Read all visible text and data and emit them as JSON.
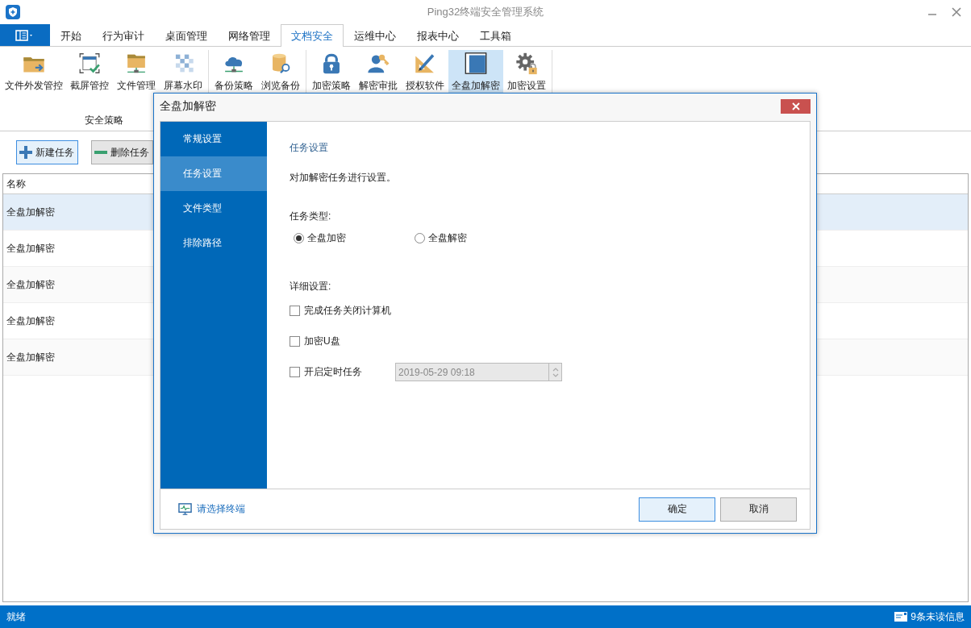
{
  "window": {
    "title": "Ping32终端安全管理系统"
  },
  "tabs": [
    {
      "label": "开始",
      "selected": false
    },
    {
      "label": "行为审计",
      "selected": false
    },
    {
      "label": "桌面管理",
      "selected": false
    },
    {
      "label": "网络管理",
      "selected": false
    },
    {
      "label": "文档安全",
      "selected": true
    },
    {
      "label": "运维中心",
      "selected": false
    },
    {
      "label": "报表中心",
      "selected": false
    },
    {
      "label": "工具箱",
      "selected": false
    }
  ],
  "ribbon": {
    "groups": [
      {
        "label": "安全策略",
        "items": [
          {
            "label": "文件外发管控",
            "selected": false
          },
          {
            "label": "截屏管控",
            "selected": false
          },
          {
            "label": "文件管理",
            "selected": false
          },
          {
            "label": "屏幕水印",
            "selected": false
          }
        ]
      },
      {
        "items": [
          {
            "label": "备份策略",
            "selected": false
          },
          {
            "label": "浏览备份",
            "selected": false
          }
        ]
      },
      {
        "items": [
          {
            "label": "加密策略",
            "selected": false
          },
          {
            "label": "解密审批",
            "selected": false
          },
          {
            "label": "授权软件",
            "selected": false
          },
          {
            "label": "全盘加解密",
            "selected": true
          },
          {
            "label": "加密设置",
            "selected": false
          }
        ]
      }
    ]
  },
  "toolbar": [
    {
      "label": "新建任务",
      "kind": "add"
    },
    {
      "label": "删除任务",
      "kind": "remove"
    }
  ],
  "table": {
    "columns": [
      "名称"
    ],
    "rows": [
      {
        "cells": [
          "全盘加解密"
        ],
        "selected": true
      },
      {
        "cells": [
          "全盘加解密"
        ],
        "selected": false
      },
      {
        "cells": [
          "全盘加解密"
        ],
        "selected": false
      },
      {
        "cells": [
          "全盘加解密"
        ],
        "selected": false
      },
      {
        "cells": [
          "全盘加解密"
        ],
        "selected": false
      }
    ]
  },
  "dialog": {
    "title": "全盘加解密",
    "nav": [
      {
        "label": "常规设置",
        "selected": false
      },
      {
        "label": "任务设置",
        "selected": true
      },
      {
        "label": "文件类型",
        "selected": false
      },
      {
        "label": "排除路径",
        "selected": false
      }
    ],
    "section_title": "任务设置",
    "description": "对加解密任务进行设置。",
    "task_type_label": "任务类型:",
    "task_types": [
      {
        "label": "全盘加密",
        "selected": true
      },
      {
        "label": "全盘解密",
        "selected": false
      }
    ],
    "detail_label": "详细设置:",
    "options": [
      {
        "label": "完成任务关闭计算机",
        "checked": false
      },
      {
        "label": "加密U盘",
        "checked": false
      },
      {
        "label": "开启定时任务",
        "checked": false,
        "datetime": {
          "value": "2019-05-29 09:18",
          "disabled": true
        }
      }
    ],
    "terminal_link": "请选择终端",
    "buttons": [
      {
        "label": "确定",
        "default": true
      },
      {
        "label": "取消",
        "default": false
      }
    ]
  },
  "status_bar": {
    "text": "就绪",
    "messages": "9条未读信息"
  }
}
